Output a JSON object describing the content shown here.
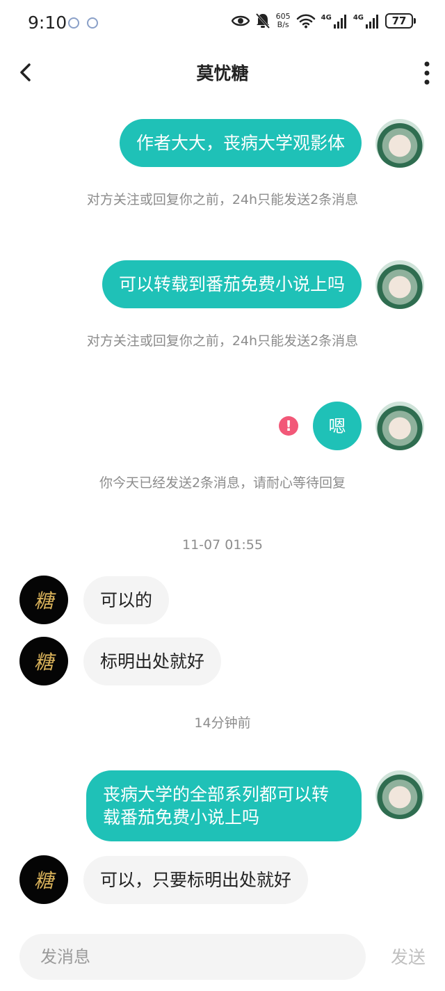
{
  "status_bar": {
    "time": "9:10",
    "net_speed_value": "605",
    "net_speed_unit": "B/s",
    "signal_1_label": "4G",
    "signal_2_label": "4G",
    "battery": "77"
  },
  "header": {
    "title": "莫忧糖"
  },
  "messages": [
    {
      "from": "me",
      "text": "作者大大，丧病大学观影体"
    },
    {
      "system": "对方关注或回复你之前，24h只能发送2条消息"
    },
    {
      "from": "me",
      "text": "可以转载到番茄免费小说上吗"
    },
    {
      "system": "对方关注或回复你之前，24h只能发送2条消息"
    },
    {
      "from": "me",
      "text": "嗯",
      "failed": true
    },
    {
      "system": "你今天已经发送2条消息，请耐心等待回复"
    },
    {
      "timestamp": "11-07 01:55"
    },
    {
      "from": "other",
      "text": "可以的"
    },
    {
      "from": "other",
      "text": "标明出处就好"
    },
    {
      "timestamp": "14分钟前"
    },
    {
      "from": "me",
      "text": "丧病大学的全部系列都可以转载番茄免费小说上吗"
    },
    {
      "from": "other",
      "text": "可以，只要标明出处就好"
    }
  ],
  "other_avatar_text": "糖",
  "input": {
    "placeholder": "发消息",
    "value": "",
    "send_label": "发送"
  },
  "colors": {
    "my_bubble": "#1fc1b7",
    "other_bubble": "#f4f4f4",
    "error": "#f25878"
  }
}
